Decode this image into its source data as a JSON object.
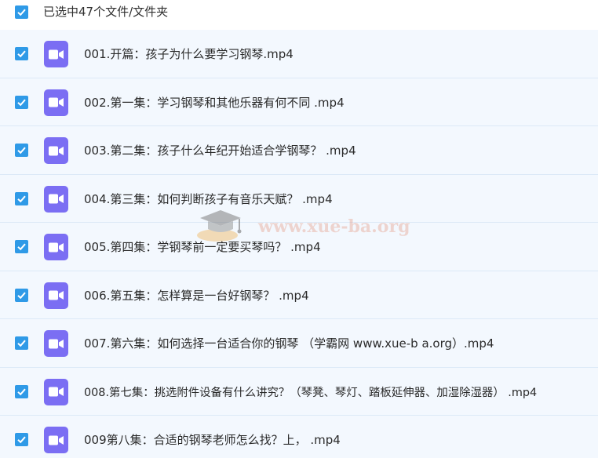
{
  "header": {
    "selection_label": "已选中47个文件/文件夹",
    "select_all_checked": true
  },
  "files": [
    {
      "name": "001.开篇：孩子为什么要学习钢琴.mp4",
      "checked": true,
      "icon": "video-icon"
    },
    {
      "name": "002.第一集：学习钢琴和其他乐器有何不同 .mp4",
      "checked": true,
      "icon": "video-icon"
    },
    {
      "name": "003.第二集：孩子什么年纪开始适合学钢琴？ .mp4",
      "checked": true,
      "icon": "video-icon"
    },
    {
      "name": "004.第三集：如何判断孩子有音乐天赋？ .mp4",
      "checked": true,
      "icon": "video-icon"
    },
    {
      "name": "005.第四集：学钢琴前一定要买琴吗？ .mp4",
      "checked": true,
      "icon": "video-icon"
    },
    {
      "name": "006.第五集：怎样算是一台好钢琴？ .mp4",
      "checked": true,
      "icon": "video-icon"
    },
    {
      "name": "007.第六集：如何选择一台适合你的钢琴 （学霸网 www.xue-b a.org）.mp4",
      "checked": true,
      "icon": "video-icon"
    },
    {
      "name": "008.第七集：挑选附件设备有什么讲究？（琴凳、琴灯、踏板延伸器、加湿除湿器） .mp4",
      "checked": true,
      "icon": "video-icon"
    },
    {
      "name": "009第八集：合适的钢琴老师怎么找？上， .mp4",
      "checked": true,
      "icon": "video-icon"
    }
  ],
  "watermark": {
    "text": "www.xue-ba.org",
    "icon": "graduation-cap-icon"
  },
  "colors": {
    "checkbox": "#2f9ae7",
    "file_icon": "#7b6ef3",
    "row_background": "#f3f8fe",
    "row_border": "#dce9f7"
  }
}
